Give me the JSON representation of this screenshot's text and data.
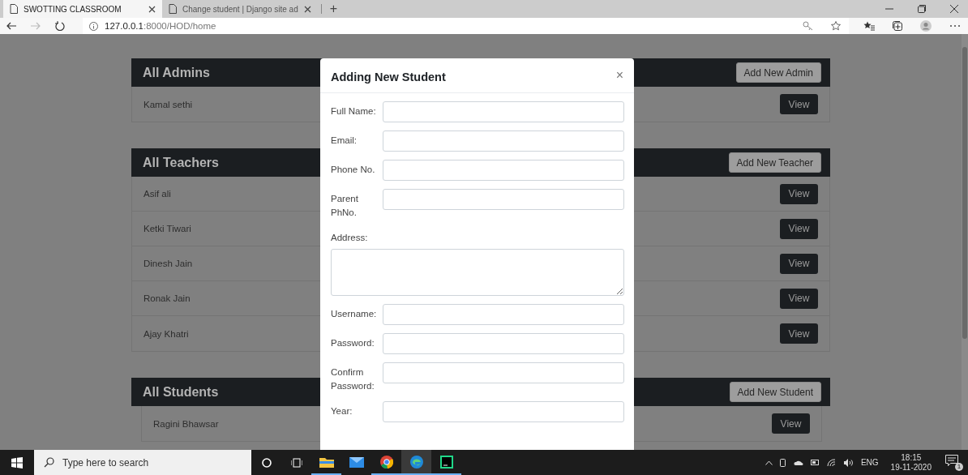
{
  "browser": {
    "tabs": [
      {
        "title": "SWOTTING CLASSROOM",
        "selected": true
      },
      {
        "title": "Change student | Django site ad",
        "selected": false
      }
    ],
    "new_tab": "+",
    "address": {
      "host": "127.0.0.1",
      "path": ":8000/HOD/home"
    }
  },
  "sections": [
    {
      "title": "All Admins",
      "button": "Add New Admin",
      "rows": [
        {
          "name": "Kamal sethi",
          "action": "View"
        }
      ]
    },
    {
      "title": "All Teachers",
      "button": "Add New Teacher",
      "rows": [
        {
          "name": "Asif ali",
          "action": "View"
        },
        {
          "name": "Ketki Tiwari",
          "action": "View"
        },
        {
          "name": "Dinesh Jain",
          "action": "View"
        },
        {
          "name": "Ronak Jain",
          "action": "View"
        },
        {
          "name": "Ajay Khatri",
          "action": "View"
        }
      ]
    },
    {
      "title": "All Students",
      "button": "Add New Student",
      "rows": [
        {
          "name": "Ragini Bhawsar",
          "action": "View"
        }
      ]
    }
  ],
  "modal": {
    "title": "Adding New Student",
    "close": "×",
    "fields": [
      {
        "label": "Full Name:",
        "kind": "input"
      },
      {
        "label": "Email:",
        "kind": "input"
      },
      {
        "label": "Phone No.",
        "kind": "input"
      },
      {
        "label": "Parent PhNo.",
        "kind": "input"
      },
      {
        "label": "Address:",
        "kind": "textarea"
      },
      {
        "label": "Username:",
        "kind": "input"
      },
      {
        "label": "Password:",
        "kind": "input"
      },
      {
        "label": "Confirm Password:",
        "kind": "input"
      },
      {
        "label": "Year:",
        "kind": "input"
      }
    ]
  },
  "taskbar": {
    "search": {
      "placeholder": "Type here to search"
    },
    "language": "ENG",
    "time": "18:15",
    "date": "19-11-2020",
    "notifications": "1"
  }
}
